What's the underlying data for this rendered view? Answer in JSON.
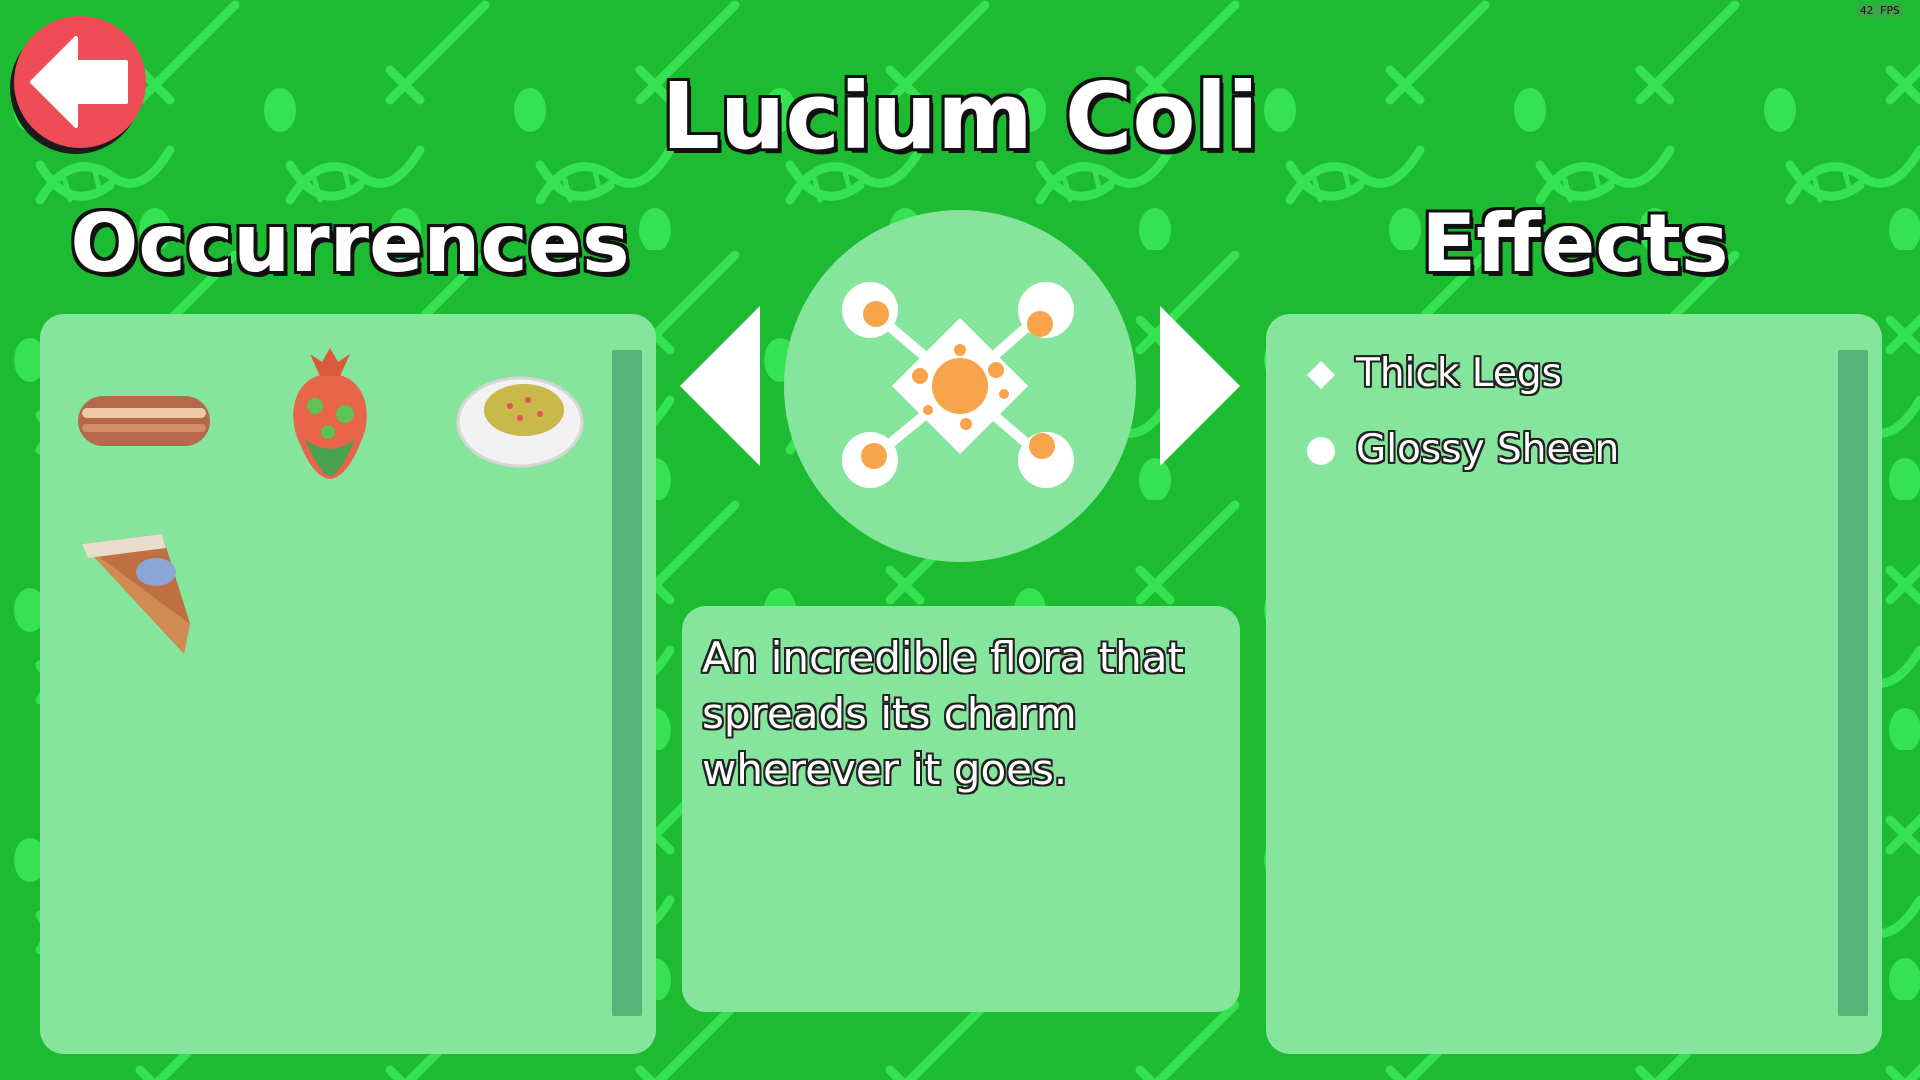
{
  "title": "Lucium Coli",
  "occurrences": {
    "heading": "Occurrences",
    "items": [
      {
        "icon": "hotdog-bun-icon"
      },
      {
        "icon": "strawberry-icon"
      },
      {
        "icon": "deviled-egg-icon"
      },
      {
        "icon": "pie-slice-icon"
      }
    ]
  },
  "effects": {
    "heading": "Effects",
    "items": [
      {
        "label": "Thick Legs",
        "icon": "diamond-icon"
      },
      {
        "label": "Glossy Sheen",
        "icon": "circle-icon"
      }
    ]
  },
  "description": "An incredible flora that spreads its charm wherever it goes.",
  "germ": {
    "icon": "germ-molecule-icon"
  },
  "navigation": {
    "back_icon": "back-arrow-icon",
    "prev_icon": "left-triangle-icon",
    "next_icon": "right-triangle-icon"
  },
  "fps": "42 FPS",
  "colors": {
    "background": "#1dbb32",
    "panel": "#85e59c",
    "back_button": "#ee4d57",
    "germ": "#f7a44a"
  }
}
